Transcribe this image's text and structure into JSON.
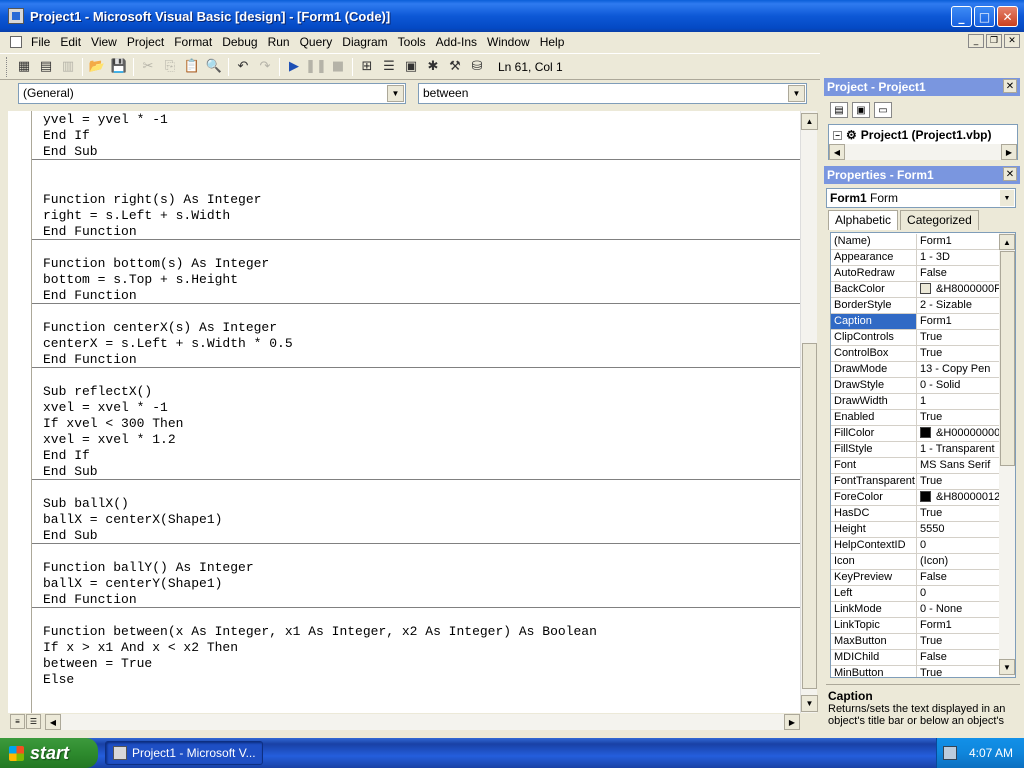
{
  "window": {
    "title": "Project1 - Microsoft Visual Basic [design] - [Form1 (Code)]"
  },
  "menu": [
    "File",
    "Edit",
    "View",
    "Project",
    "Format",
    "Debug",
    "Run",
    "Query",
    "Diagram",
    "Tools",
    "Add-Ins",
    "Window",
    "Help"
  ],
  "toolbar": {
    "position": "Ln 61, Col 1"
  },
  "code": {
    "object_combo": "(General)",
    "procedure_combo": "between",
    "lines": [
      "yvel = yvel * -1",
      "End If",
      "End Sub",
      "",
      "",
      "Function right(s) As Integer",
      "right = s.Left + s.Width",
      "End Function",
      "",
      "Function bottom(s) As Integer",
      "bottom = s.Top + s.Height",
      "End Function",
      "",
      "Function centerX(s) As Integer",
      "centerX = s.Left + s.Width * 0.5",
      "End Function",
      "",
      "Sub reflectX()",
      "xvel = xvel * -1",
      "If xvel < 300 Then",
      "xvel = xvel * 1.2",
      "End If",
      "End Sub",
      "",
      "Sub ballX()",
      "ballX = centerX(Shape1)",
      "End Sub",
      "",
      "Function ballY() As Integer",
      "ballX = centerY(Shape1)",
      "End Function",
      "",
      "Function between(x As Integer, x1 As Integer, x2 As Integer) As Boolean",
      "If x > x1 And x < x2 Then",
      "between = True",
      "Else"
    ],
    "separator_after_line": [
      2,
      7,
      11,
      15,
      22,
      26,
      30
    ]
  },
  "project_pane": {
    "title": "Project - Project1",
    "tree_item": "Project1 (Project1.vbp)"
  },
  "properties_pane": {
    "title": "Properties - Form1",
    "object_name": "Form1",
    "object_type": "Form",
    "tabs": [
      "Alphabetic",
      "Categorized"
    ],
    "selected": "Caption",
    "rows": [
      {
        "name": "(Name)",
        "value": "Form1"
      },
      {
        "name": "Appearance",
        "value": "1 - 3D"
      },
      {
        "name": "AutoRedraw",
        "value": "False"
      },
      {
        "name": "BackColor",
        "value": "&H8000000F",
        "swatch": "#ece9d8"
      },
      {
        "name": "BorderStyle",
        "value": "2 - Sizable"
      },
      {
        "name": "Caption",
        "value": "Form1"
      },
      {
        "name": "ClipControls",
        "value": "True"
      },
      {
        "name": "ControlBox",
        "value": "True"
      },
      {
        "name": "DrawMode",
        "value": "13 - Copy Pen"
      },
      {
        "name": "DrawStyle",
        "value": "0 - Solid"
      },
      {
        "name": "DrawWidth",
        "value": "1"
      },
      {
        "name": "Enabled",
        "value": "True"
      },
      {
        "name": "FillColor",
        "value": "&H00000000",
        "swatch": "#000000"
      },
      {
        "name": "FillStyle",
        "value": "1 - Transparent"
      },
      {
        "name": "Font",
        "value": "MS Sans Serif"
      },
      {
        "name": "FontTransparent",
        "value": "True"
      },
      {
        "name": "ForeColor",
        "value": "&H80000012",
        "swatch": "#000000"
      },
      {
        "name": "HasDC",
        "value": "True"
      },
      {
        "name": "Height",
        "value": "5550"
      },
      {
        "name": "HelpContextID",
        "value": "0"
      },
      {
        "name": "Icon",
        "value": "(Icon)"
      },
      {
        "name": "KeyPreview",
        "value": "False"
      },
      {
        "name": "Left",
        "value": "0"
      },
      {
        "name": "LinkMode",
        "value": "0 - None"
      },
      {
        "name": "LinkTopic",
        "value": "Form1"
      },
      {
        "name": "MaxButton",
        "value": "True"
      },
      {
        "name": "MDIChild",
        "value": "False"
      },
      {
        "name": "MinButton",
        "value": "True"
      }
    ],
    "description_title": "Caption",
    "description_text": "Returns/sets the text displayed in an object's title bar or below an object's"
  },
  "taskbar": {
    "start_label": "start",
    "task_label": "Project1 - Microsoft V...",
    "clock": "4:07 AM"
  },
  "colors": {
    "titlebar": "#0a5ed8",
    "selection": "#316ac5",
    "pane_title": "#7a96df"
  }
}
